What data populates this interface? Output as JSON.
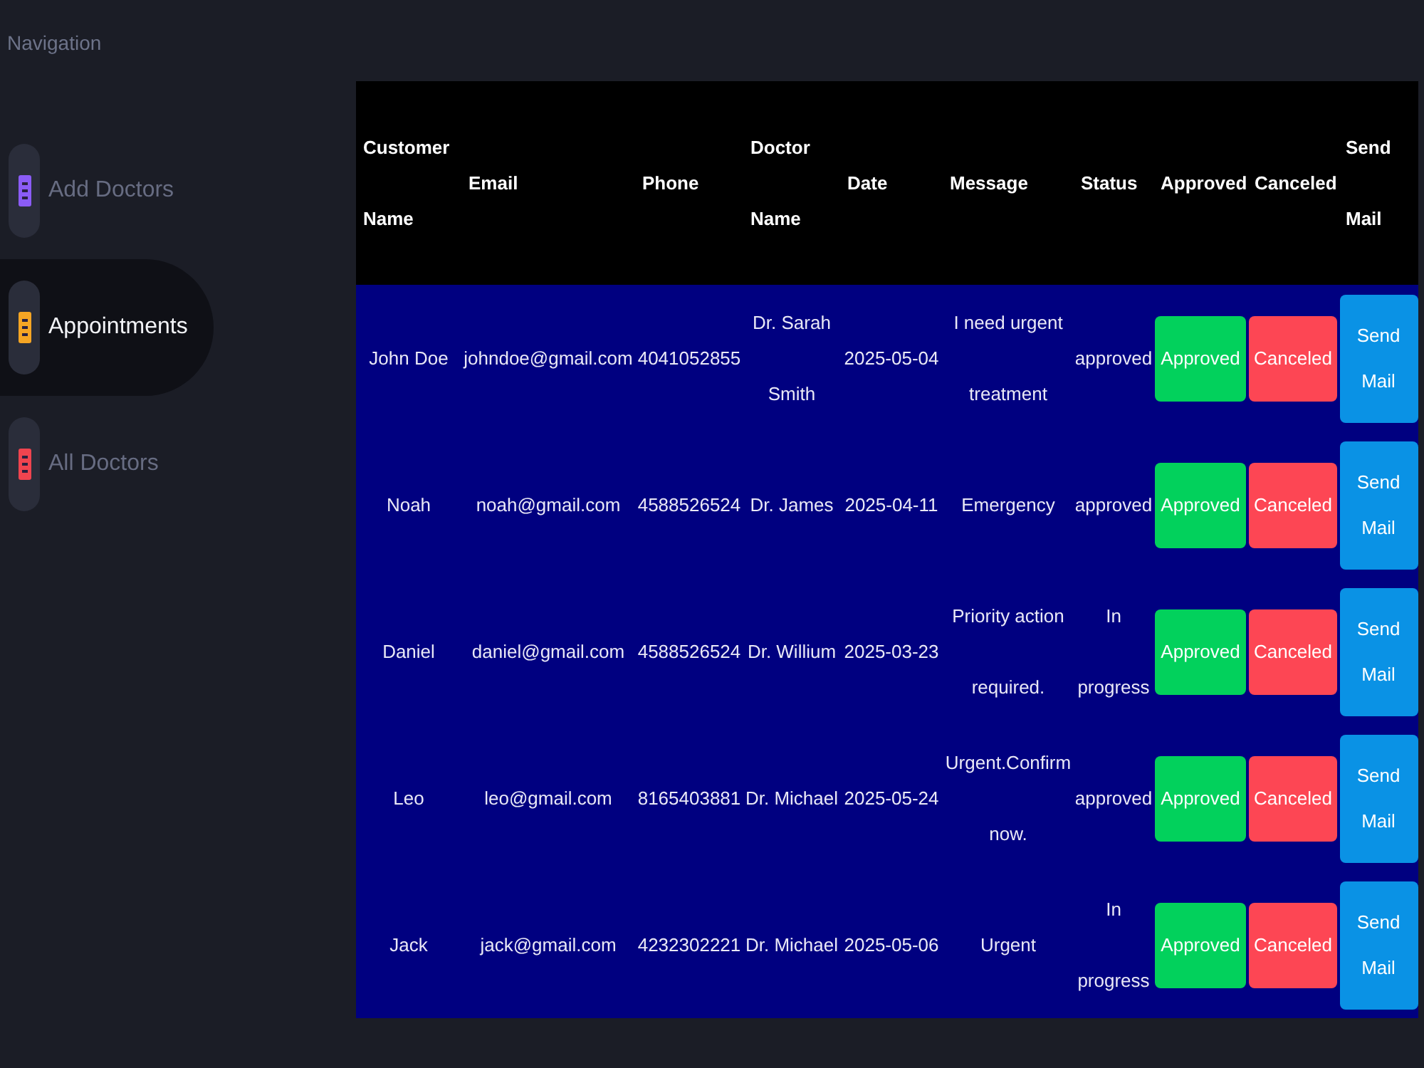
{
  "sidebar": {
    "heading": "Navigation",
    "items": [
      {
        "label": "Add Doctors",
        "color": "#8b5cf6",
        "selected": false
      },
      {
        "label": "Appointments",
        "color": "#f5a524",
        "selected": true
      },
      {
        "label": "All Doctors",
        "color": "#f0444f",
        "selected": false
      }
    ]
  },
  "table": {
    "columns": [
      "Customer Name",
      "Email",
      "Phone",
      "Doctor Name",
      "Date",
      "Message",
      "Status",
      "Approved",
      "Canceled",
      "Send Mail"
    ],
    "rows": [
      {
        "customer_name": "John Doe",
        "email": "johndoe@gmail.com",
        "phone": "4041052855",
        "doctor_name": "Dr. Sarah Smith",
        "date": "2025-05-04",
        "message": "I need urgent treatment",
        "status": "approved",
        "buttons": [
          {
            "kind": "approve",
            "label": "Approved"
          },
          {
            "kind": "cancel",
            "label": "Canceled"
          },
          {
            "kind": "mail",
            "label": "Send Mail"
          }
        ]
      },
      {
        "customer_name": "Noah",
        "email": "noah@gmail.com",
        "phone": "4588526524",
        "doctor_name": "Dr. James",
        "date": "2025-04-11",
        "message": "Emergency",
        "status": "approved",
        "buttons": [
          {
            "kind": "approve",
            "label": "Approved"
          },
          {
            "kind": "cancel",
            "label": "Canceled"
          },
          {
            "kind": "mail",
            "label": "Send Mail"
          }
        ]
      },
      {
        "customer_name": "Daniel",
        "email": "daniel@gmail.com",
        "phone": "4588526524",
        "doctor_name": "Dr. Willium",
        "date": "2025-03-23",
        "message": "Priority action required.",
        "status": "In progress",
        "buttons": [
          {
            "kind": "approve",
            "label": "Approved"
          },
          {
            "kind": "cancel",
            "label": "Canceled"
          },
          {
            "kind": "mail",
            "label": "Send Mail"
          }
        ]
      },
      {
        "customer_name": "Leo",
        "email": "leo@gmail.com",
        "phone": "8165403881",
        "doctor_name": "Dr. Michael",
        "date": "2025-05-24",
        "message": "Urgent.Confirm now.",
        "status": "approved",
        "buttons": [
          {
            "kind": "approve",
            "label": "Approved"
          },
          {
            "kind": "cancel",
            "label": "Canceled"
          },
          {
            "kind": "mail",
            "label": "Send Mail"
          }
        ]
      },
      {
        "customer_name": "Jack",
        "email": "jack@gmail.com",
        "phone": "4232302221",
        "doctor_name": "Dr. Michael",
        "date": "2025-05-06",
        "message": "Urgent",
        "status": "In progress",
        "buttons": [
          {
            "kind": "approve",
            "label": "Approved"
          },
          {
            "kind": "cancel",
            "label": "Canceled"
          },
          {
            "kind": "mail",
            "label": "Send Mail"
          }
        ]
      }
    ]
  }
}
